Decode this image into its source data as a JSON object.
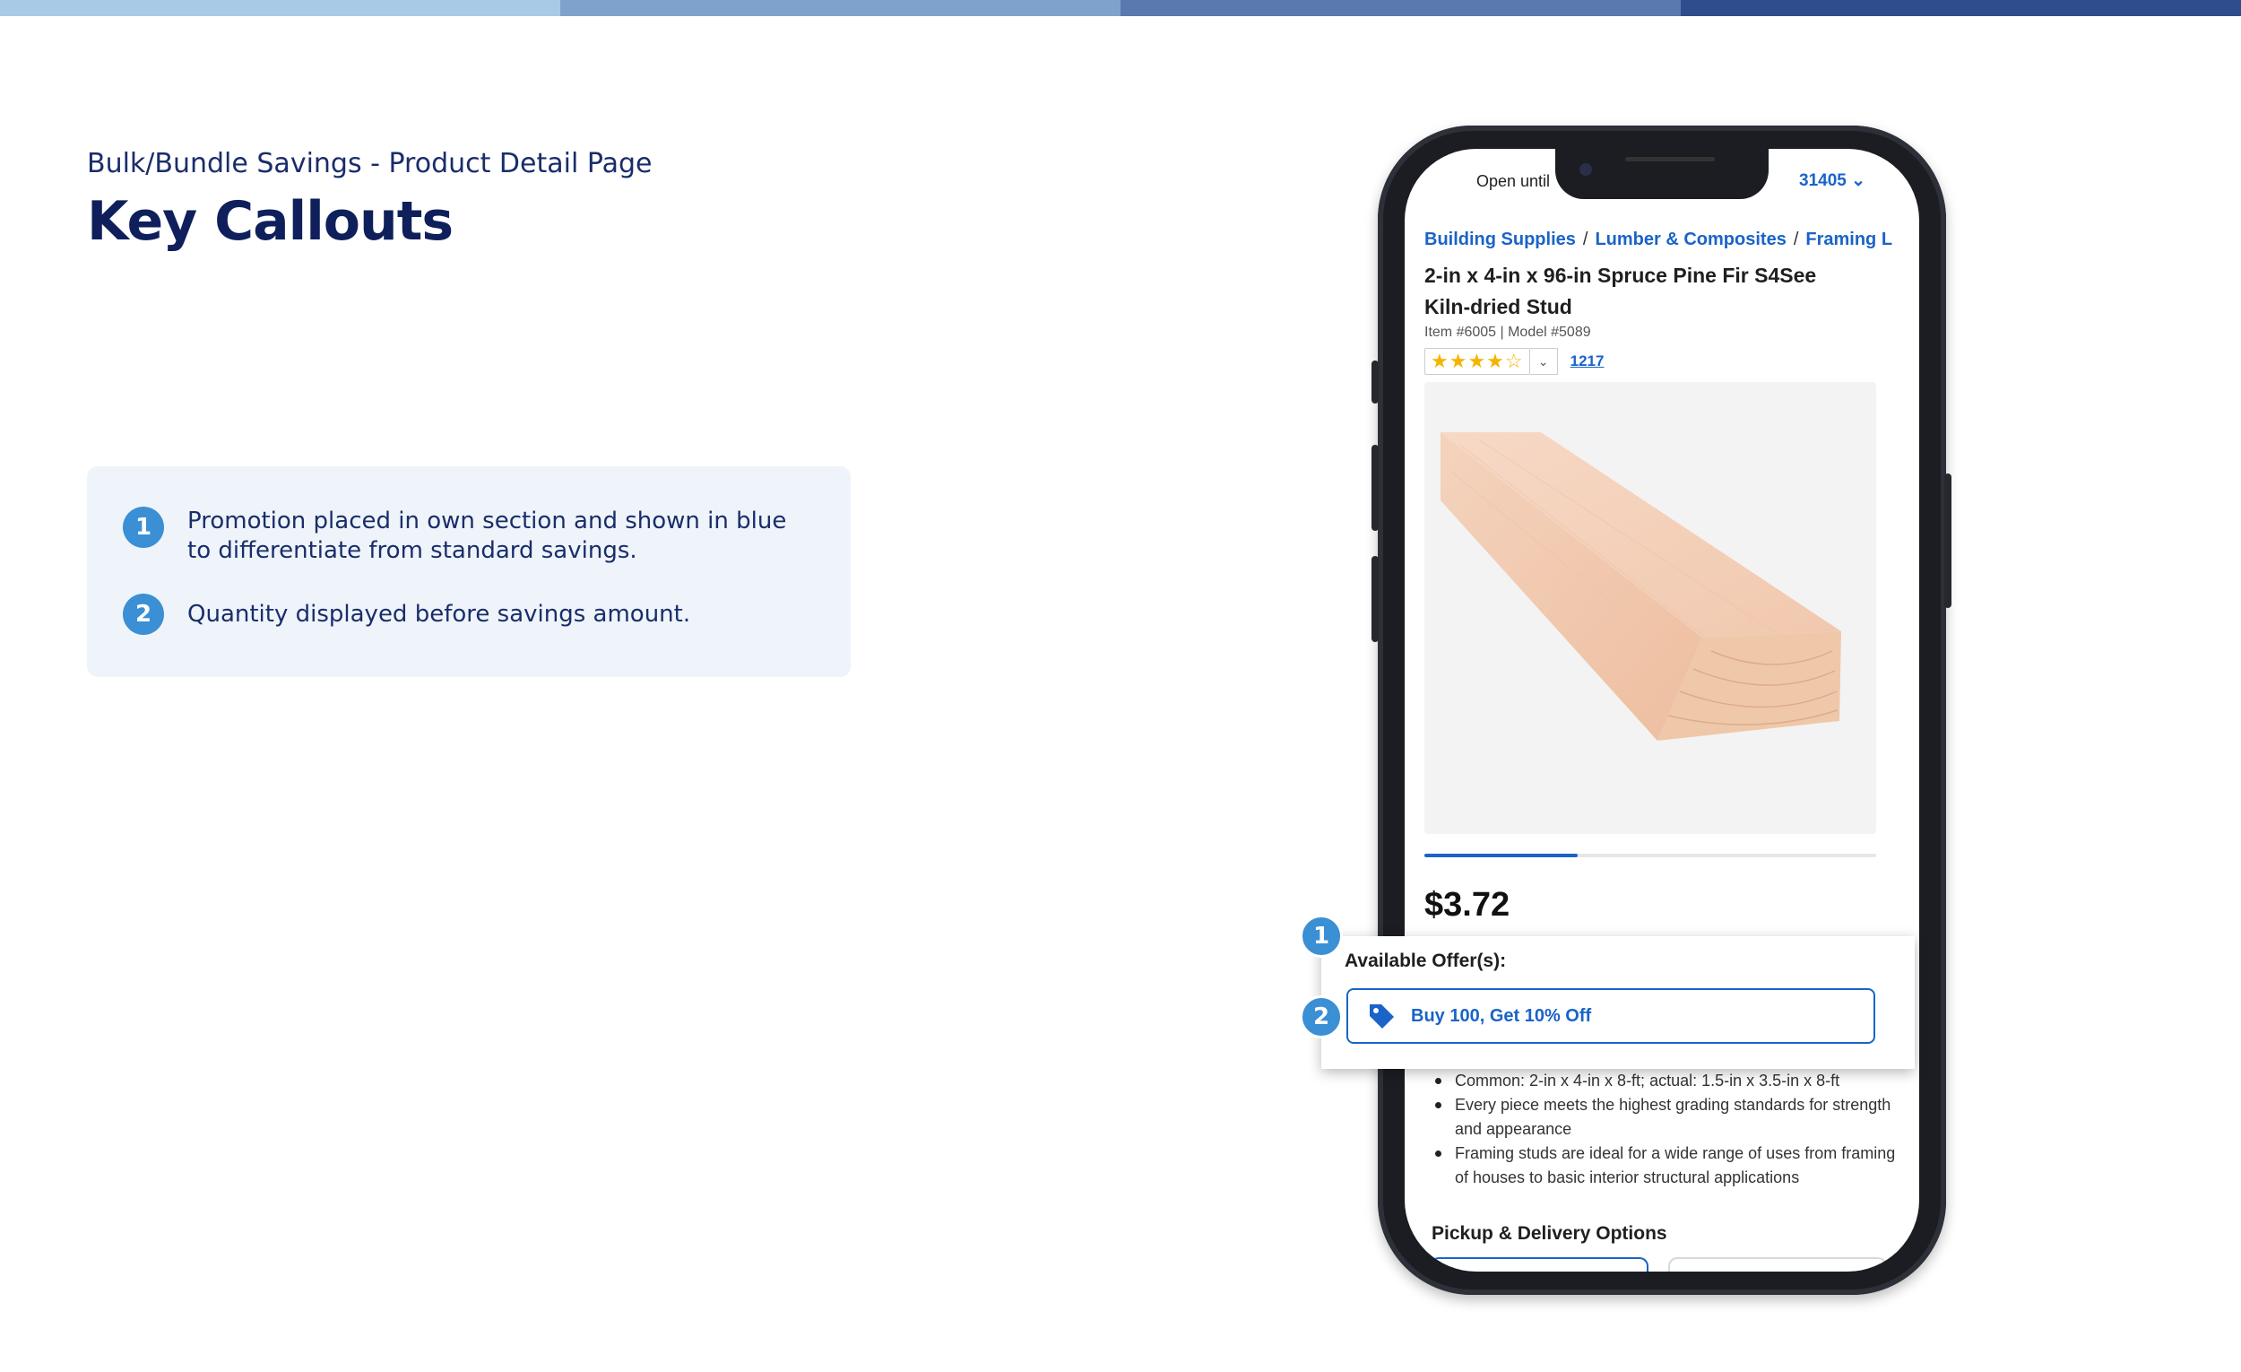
{
  "header": {
    "subtitle": "Bulk/Bundle Savings - Product Detail Page",
    "title": "Key Callouts",
    "bar_colors": [
      "#a9cae6",
      "#7fa2cc",
      "#5a79ad",
      "#2f4c8c"
    ]
  },
  "callouts": [
    {
      "number": "1",
      "text": "Promotion placed in own section and shown in blue to differentiate from standard savings."
    },
    {
      "number": "2",
      "text": "Quantity displayed before savings amount."
    }
  ],
  "phone": {
    "status_left": "Open until",
    "status_right": "31405 ⌄",
    "breadcrumb": [
      "Building Supplies",
      "Lumber & Composites",
      "Framing L"
    ],
    "product_title": "2-in x 4-in x 96-in Spruce Pine Fir S4See Kiln-dried Stud",
    "item_model": "Item #6005 | Model #5089",
    "rating_stars": "★★★★☆",
    "rating_value": 4,
    "review_count": "1217",
    "image_carousel_progress": 0.34,
    "price": "$3.72",
    "bullets": [
      "Common: 2-in x 4-in x 8-ft; actual: 1.5-in x 3.5-in x 8-ft",
      "Every piece meets the highest grading standards for strength and appearance",
      "Framing studs are ideal for a wide range of uses from framing of houses to basic interior structural applications"
    ],
    "pickup_heading": "Pickup & Delivery Options"
  },
  "offer": {
    "title": "Available Offer(s):",
    "button_label": "Buy 100, Get 10% Off",
    "icon": "price-tag-icon",
    "accent": "#1a63c9"
  },
  "badges": {
    "one": "1",
    "two": "2"
  }
}
